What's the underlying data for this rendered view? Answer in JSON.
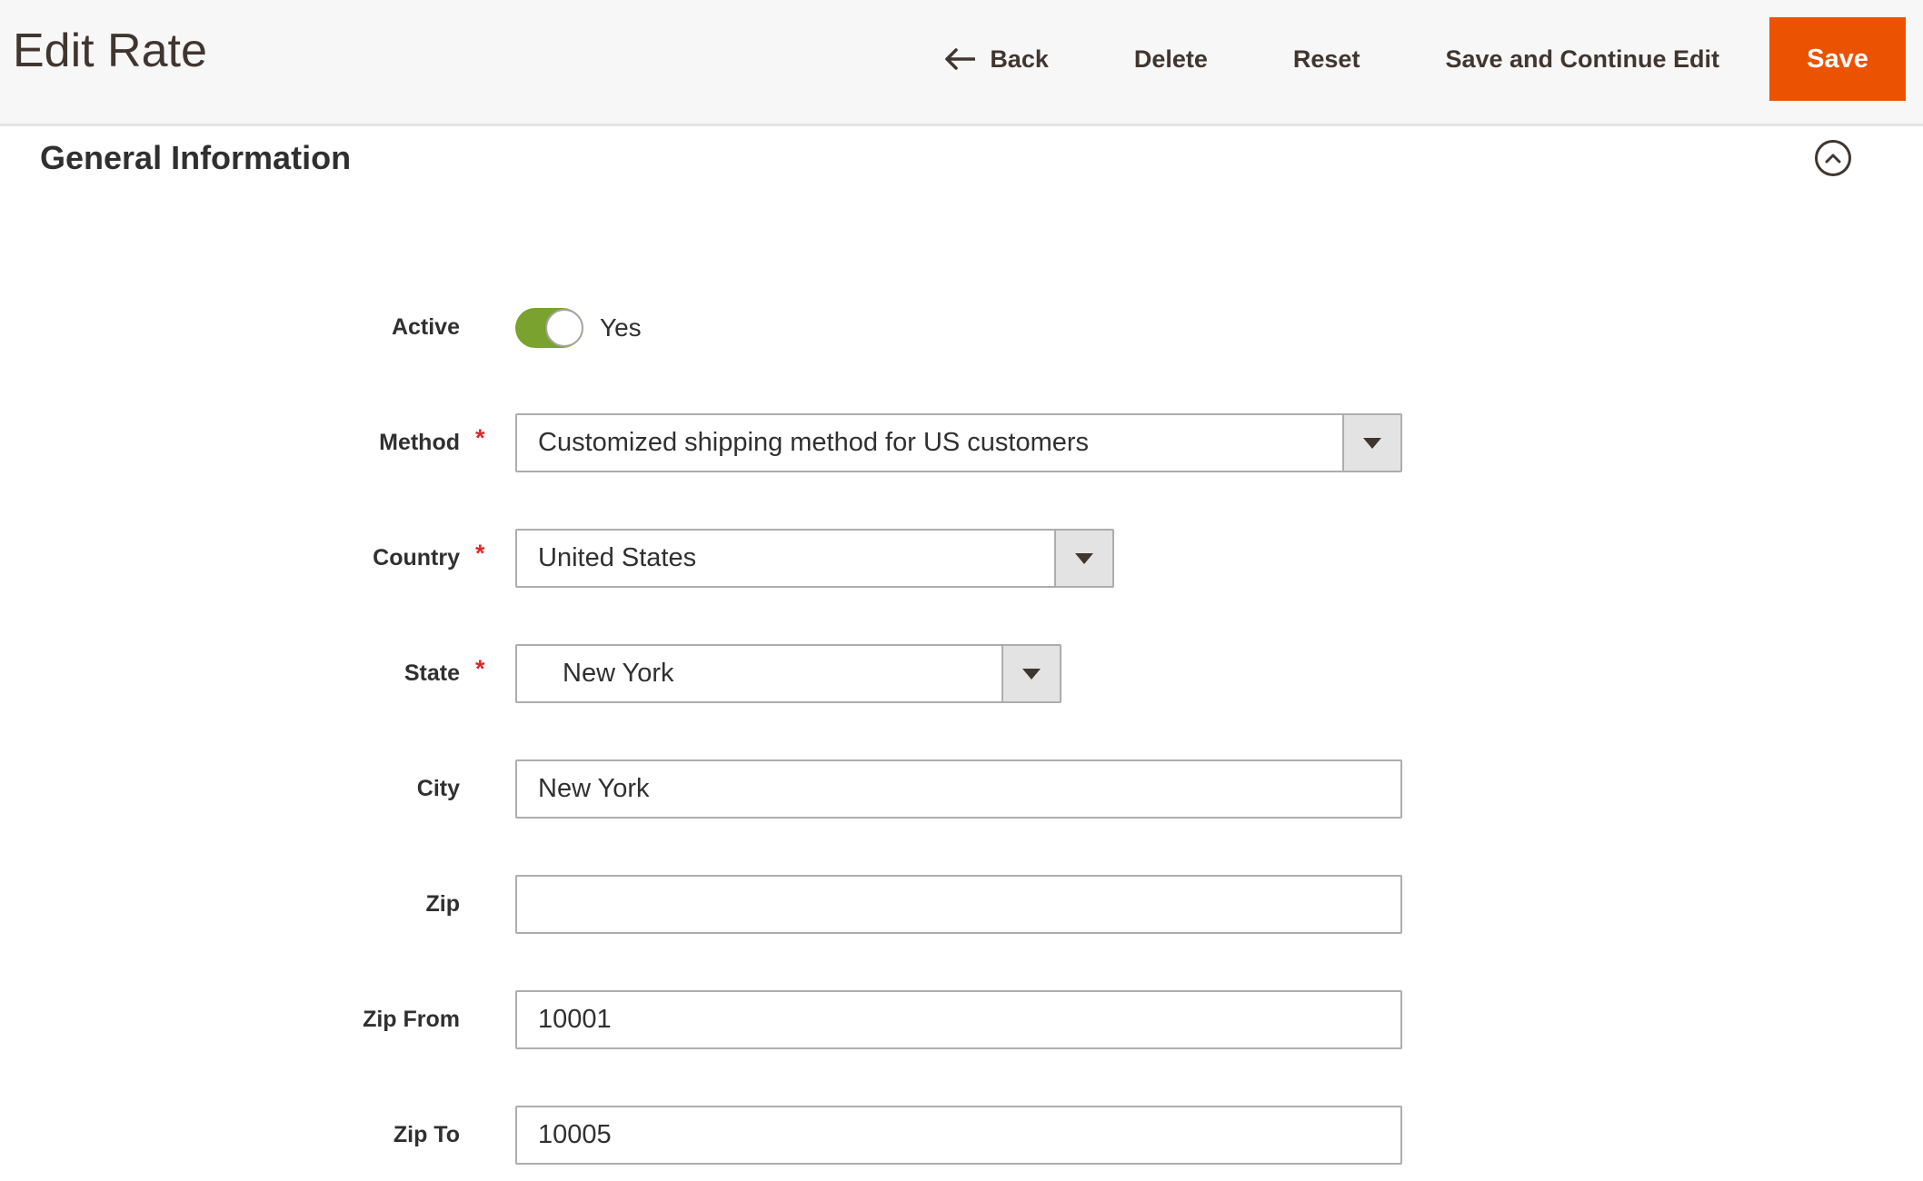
{
  "header": {
    "title": "Edit Rate",
    "actions": {
      "back_label": "Back",
      "delete_label": "Delete",
      "reset_label": "Reset",
      "save_continue_label": "Save and Continue Edit",
      "save_label": "Save"
    }
  },
  "section": {
    "title": "General Information"
  },
  "form": {
    "required_marker": "*",
    "active": {
      "label": "Active",
      "value": "Yes",
      "state": "on"
    },
    "method": {
      "label": "Method",
      "required": true,
      "value": "Customized shipping method for US customers"
    },
    "country": {
      "label": "Country",
      "required": true,
      "value": "United States"
    },
    "state": {
      "label": "State",
      "required": true,
      "value": "New York"
    },
    "city": {
      "label": "City",
      "value": "New York"
    },
    "zip": {
      "label": "Zip",
      "value": ""
    },
    "zip_from": {
      "label": "Zip From",
      "value": "10001"
    },
    "zip_to": {
      "label": "Zip To",
      "value": "10005"
    }
  },
  "icons": {
    "back": "arrow-left",
    "collapse": "chevron-up",
    "dropdown": "caret-down"
  },
  "colors": {
    "accent_orange": "#eb5202",
    "toggle_on_green": "#79a22e",
    "required_red": "#e22626",
    "header_text": "#41362f",
    "body_text": "#303030",
    "header_bg": "#f7f7f7",
    "border_gray": "#adadad",
    "arrow_box_bg": "#e3e3e3"
  }
}
